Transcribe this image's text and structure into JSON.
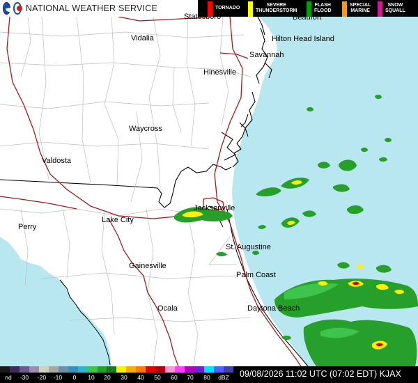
{
  "header": {
    "agency": "NATIONAL WEATHER SERVICE",
    "warnings": [
      {
        "label_1": "TORNADO",
        "label_2": "",
        "color": "#ff0000"
      },
      {
        "label_1": "SEVERE",
        "label_2": "THUNDERSTORM",
        "color": "#ffff00"
      },
      {
        "label_1": "FLASH",
        "label_2": "FLOOD",
        "color": "#00a000"
      },
      {
        "label_1": "SPECIAL",
        "label_2": "MARINE",
        "color": "#ff9900"
      },
      {
        "label_1": "SNOW",
        "label_2": "SQUALL",
        "color": "#c81e90"
      }
    ]
  },
  "map": {
    "ocean_color": "#b9e7ef",
    "land_color": "#ffffff",
    "cities": [
      {
        "name": "Statesboro"
      },
      {
        "name": "Beaufort"
      },
      {
        "name": "Vidalia"
      },
      {
        "name": "Hilton Head Island"
      },
      {
        "name": "Savannah"
      },
      {
        "name": "Hinesville"
      },
      {
        "name": "Waycross"
      },
      {
        "name": "Valdosta"
      },
      {
        "name": "Jacksonville"
      },
      {
        "name": "Lake City"
      },
      {
        "name": "Perry"
      },
      {
        "name": "St. Augustine"
      },
      {
        "name": "Gainesville"
      },
      {
        "name": "Palm Coast"
      },
      {
        "name": "Ocala"
      },
      {
        "name": "Daytona Beach"
      }
    ]
  },
  "scale": {
    "labels": [
      "nd",
      "-30",
      "-20",
      "-10",
      "0",
      "10",
      "20",
      "30",
      "40",
      "50",
      "60",
      "70",
      "80",
      "dBZ"
    ],
    "colors": [
      "#1a1a1a",
      "#3b2a5a",
      "#6c5a8f",
      "#9a8fb0",
      "#cfcfc4",
      "#a9a9a0",
      "#6e8fa8",
      "#3b8fb8",
      "#2fb5c8",
      "#3ec44a",
      "#26a02a",
      "#1b7a1e",
      "#fff200",
      "#f2b000",
      "#ff7a00",
      "#e00000",
      "#b00010",
      "#ff9ad5",
      "#ff40ff",
      "#b000c0",
      "#7020c8",
      "#00e5ff",
      "#5060ff",
      "#4040a0"
    ]
  },
  "timestamp": "09/08/2026 11:02 UTC (07:02 EDT)  KJAX"
}
